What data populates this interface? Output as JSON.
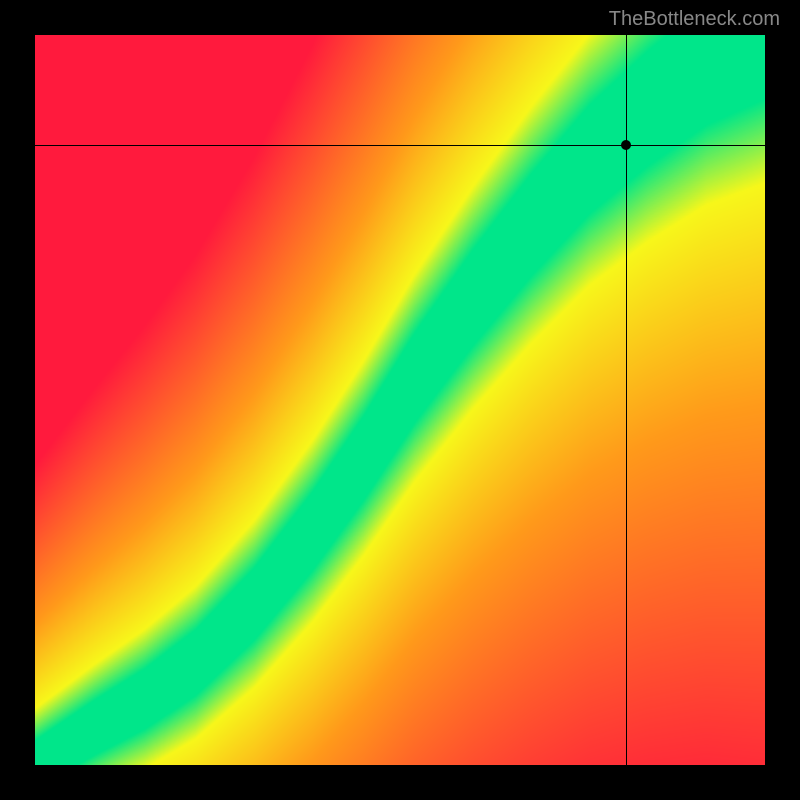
{
  "watermark": "TheBottleneck.com",
  "chart_data": {
    "type": "heatmap",
    "title": "",
    "xlabel": "",
    "ylabel": "",
    "xlim": [
      0,
      100
    ],
    "ylim": [
      0,
      100
    ],
    "marker": {
      "x": 81,
      "y": 85
    },
    "crosshair": {
      "x": 81,
      "y": 85
    },
    "optimal_curve": [
      {
        "x": 0,
        "y": 0
      },
      {
        "x": 8,
        "y": 5
      },
      {
        "x": 15,
        "y": 9
      },
      {
        "x": 22,
        "y": 14
      },
      {
        "x": 30,
        "y": 22
      },
      {
        "x": 38,
        "y": 32
      },
      {
        "x": 45,
        "y": 42
      },
      {
        "x": 52,
        "y": 53
      },
      {
        "x": 60,
        "y": 64
      },
      {
        "x": 68,
        "y": 74
      },
      {
        "x": 76,
        "y": 83
      },
      {
        "x": 84,
        "y": 90
      },
      {
        "x": 92,
        "y": 96
      },
      {
        "x": 100,
        "y": 100
      }
    ],
    "color_stops": {
      "optimal": "#00e68a",
      "near": "#f7f71a",
      "warn": "#ff9a1a",
      "bad": "#ff1a3d"
    },
    "grid_resolution": 100,
    "description": "Color field indicates bottleneck severity. Green diagonal band is the balanced CPU/GPU region; red corners indicate severe bottleneck."
  }
}
